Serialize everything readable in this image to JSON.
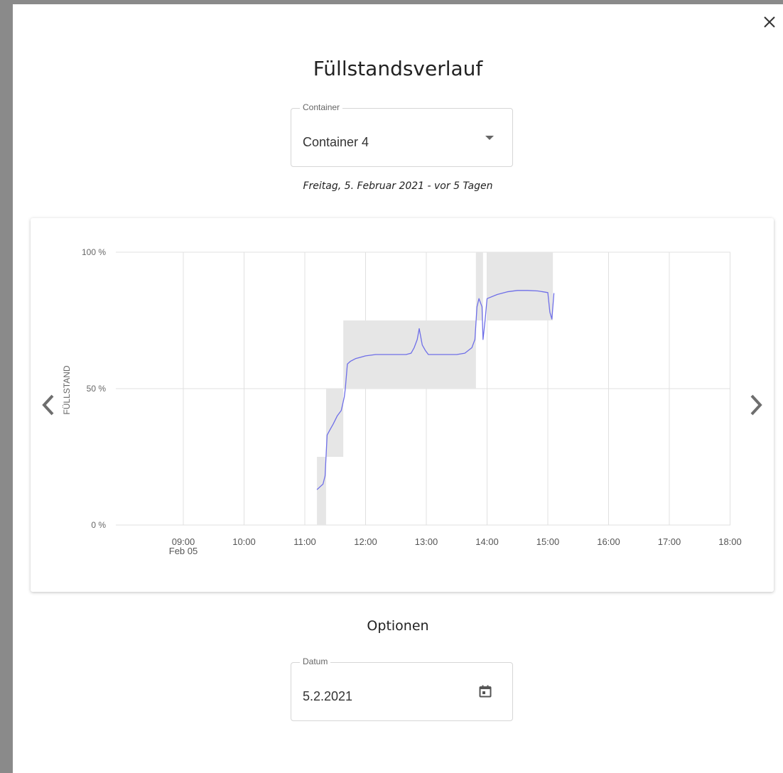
{
  "dialog": {
    "title": "Füllstandsverlauf",
    "close_icon": "close-icon",
    "container_select": {
      "label": "Container",
      "value": "Container 4"
    },
    "date_caption": "Freitag, 5. Februar 2021 - vor 5 Tagen",
    "nav": {
      "prev_icon": "chevron-left-icon",
      "next_icon": "chevron-right-icon"
    },
    "options": {
      "title": "Optionen",
      "date_field": {
        "label": "Datum",
        "value": "5.2.2021",
        "icon": "calendar-icon"
      }
    }
  },
  "chart_data": {
    "type": "line",
    "ylabel": "FÜLLSTAND",
    "y_ticks": [
      "0 %",
      "50 %",
      "100 %"
    ],
    "ylim": [
      0,
      100
    ],
    "x_ticks": [
      "09:00",
      "10:00",
      "11:00",
      "12:00",
      "13:00",
      "14:00",
      "15:00",
      "16:00",
      "17:00",
      "18:00"
    ],
    "x_date_label": "Feb 05",
    "grid": true,
    "colors": {
      "line": "#6f6fe8",
      "band": "#e6e6e6"
    },
    "series": [
      {
        "x": [
          "11:12",
          "11:15",
          "11:18",
          "11:20",
          "11:22",
          "11:25",
          "11:28",
          "11:32",
          "11:36",
          "11:39",
          "11:40",
          "11:42",
          "11:45",
          "11:50",
          "12:00",
          "12:10",
          "12:30",
          "12:40",
          "12:45",
          "12:48",
          "12:51",
          "12:53",
          "12:56",
          "12:59",
          "13:02",
          "13:10",
          "13:20",
          "13:30",
          "13:38",
          "13:45",
          "13:48",
          "13:50",
          "13:52",
          "13:55",
          "13:56",
          "13:58",
          "14:00",
          "14:10",
          "14:20",
          "14:30",
          "14:40",
          "14:50",
          "15:00",
          "15:02",
          "15:04",
          "15:05",
          "15:06"
        ],
        "values": [
          13,
          14,
          15,
          18,
          33,
          35,
          37,
          40,
          42,
          47,
          50,
          59,
          60,
          61,
          62,
          62.5,
          62.5,
          62.5,
          63,
          65,
          68,
          72,
          66,
          64,
          62.5,
          62.5,
          62.5,
          62.5,
          63,
          65,
          68,
          80,
          83,
          80,
          68,
          75,
          83,
          84.5,
          85.5,
          86,
          86,
          85.8,
          85.2,
          78,
          75.5,
          80,
          85
        ]
      }
    ],
    "bands": [
      {
        "x_start": "11:12",
        "x_end": "11:21",
        "low": 0,
        "high": 25
      },
      {
        "x_start": "11:21",
        "x_end": "11:38",
        "low": 25,
        "high": 50
      },
      {
        "x_start": "11:38",
        "x_end": "13:49",
        "low": 50,
        "high": 75
      },
      {
        "x_start": "13:49",
        "x_end": "13:56",
        "low": 75,
        "high": 100
      },
      {
        "x_start": "14:00",
        "x_end": "15:05",
        "low": 75,
        "high": 100
      }
    ]
  }
}
